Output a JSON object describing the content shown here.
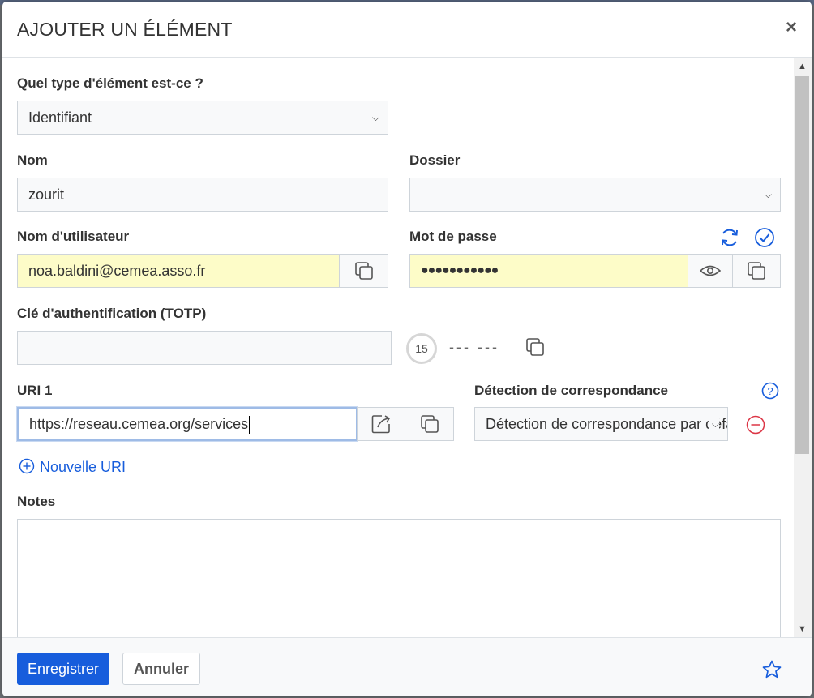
{
  "dialog": {
    "title": "AJOUTER UN ÉLÉMENT",
    "close_label": "×"
  },
  "form": {
    "type": {
      "label": "Quel type d'élément est-ce ?",
      "value": "Identifiant"
    },
    "name": {
      "label": "Nom",
      "value": "zourit"
    },
    "folder": {
      "label": "Dossier",
      "value": ""
    },
    "username": {
      "label": "Nom d'utilisateur",
      "value": "noa.baldini@cemea.asso.fr"
    },
    "password": {
      "label": "Mot de passe",
      "value": "●●●●●●●●●●●"
    },
    "totp": {
      "label": "Clé d'authentification (TOTP)",
      "value": "",
      "countdown": "15",
      "code_placeholder": "--- ---"
    },
    "uri": {
      "label": "URI 1",
      "value": "https://reseau.cemea.org/services"
    },
    "match": {
      "label": "Détection de correspondance",
      "value": "Détection de correspondance par défaut"
    },
    "new_uri_label": "Nouvelle URI",
    "notes": {
      "label": "Notes",
      "value": ""
    }
  },
  "footer": {
    "save_label": "Enregistrer",
    "cancel_label": "Annuler"
  },
  "colors": {
    "accent": "#175ddc",
    "autofill": "#fdfcc8",
    "danger": "#dc3545"
  }
}
